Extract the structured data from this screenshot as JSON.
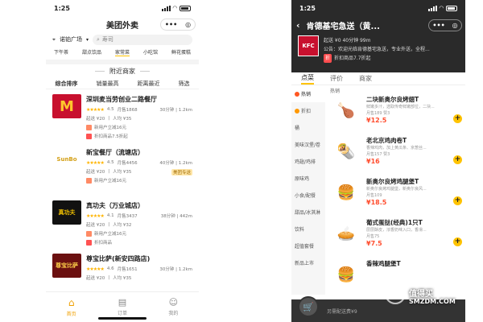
{
  "left": {
    "time": "1:25",
    "title": "美团外卖",
    "capsule_dots": "•••",
    "location": "诺铂广场",
    "search_placeholder": "寿司",
    "categories": [
      "下午茶",
      "甜点饮品",
      "家常菜",
      "小吃馆",
      "鲜花蛋糕"
    ],
    "active_category_index": 2,
    "nearby_title": "附近商家",
    "sorts": [
      "综合排序",
      "销量最高",
      "距离最近",
      "筛选"
    ],
    "shops": [
      {
        "name": "深圳麦当劳创业二路餐厅",
        "rating": "4.5",
        "sales": "月售1868",
        "min": "起送 ¥20",
        "fee": "人均 ¥35",
        "time": "30分钟",
        "dist": "1.2km",
        "tags": [
          "新用户立减16元",
          "折扣商品7.5折起"
        ],
        "tag_colors": [
          "#ff8a65",
          "#ff5252"
        ],
        "logo_text": "M",
        "logo_bg": "#c8102e",
        "logo_color": "#ffc72c",
        "badge": ""
      },
      {
        "name": "新宝餐厅（流塘店）",
        "rating": "4.5",
        "sales": "月售4456",
        "min": "起送 ¥20",
        "fee": "人均 ¥35",
        "time": "40分钟",
        "dist": "1.2km",
        "tags": [
          "新用户立减16元"
        ],
        "tag_colors": [
          "#ff8a65"
        ],
        "logo_text": "SunBo",
        "logo_bg": "#fff",
        "logo_color": "#d4a017",
        "badge": "美团专送"
      },
      {
        "name": "真功夫（万业城店）",
        "rating": "4.1",
        "sales": "月售3437",
        "min": "起送 ¥20",
        "fee": "人均 ¥32",
        "time": "38分钟",
        "dist": "442m",
        "tags": [
          "新用户立减16元",
          "折扣商品"
        ],
        "tag_colors": [
          "#ff8a65",
          "#ff5252"
        ],
        "logo_text": "真功夫",
        "logo_bg": "#111",
        "logo_color": "#f5c400",
        "badge": ""
      },
      {
        "name": "尊宝比萨(新安四路店)",
        "rating": "4.6",
        "sales": "月售1651",
        "min": "起送 ¥20",
        "fee": "人均 ¥35",
        "time": "30分钟",
        "dist": "1.2km",
        "tags": [],
        "tag_colors": [],
        "logo_text": "尊宝比萨",
        "logo_bg": "#6b1010",
        "logo_color": "#ffd24a",
        "badge": ""
      }
    ],
    "tabs": [
      "首页",
      "订单",
      "我的"
    ]
  },
  "right": {
    "time": "1:25",
    "title": "肯德基宅急送（黄...",
    "capsule_dots": "•••",
    "line1": "起送 ¥0   40分钟   99m",
    "notice": "公告：欢迎光临肯德基宅急送，专业外送，全程...",
    "promo_tag": "折",
    "promo": "折扣商品7.7折起",
    "logo_text": "KFC",
    "tabs": [
      "点菜",
      "评价",
      "商家"
    ],
    "side": [
      "热销",
      "折扣",
      "桶",
      "美味汉堡/卷",
      "鸡翅/鸡排",
      "原味鸡",
      "小食/配餐",
      "甜品/冰淇淋",
      "饮料",
      "超值套餐",
      "新品上市"
    ],
    "side_colors": [
      "#ff5722",
      "#ff9800"
    ],
    "list_title": "热销",
    "items": [
      {
        "name": "二块新奥尔良烤翅T",
        "desc": "鲜嫩多汁，选取传奇鲜嫩部位，二块...",
        "sale": "月售189  赞3",
        "price": "¥12.5",
        "emoji": "🍗"
      },
      {
        "name": "老北京鸡肉卷T",
        "desc": "香辣鸡肉，加上黄瓜条、京葱丝...",
        "sale": "月售157  赞3",
        "price": "¥16",
        "emoji": "🌯"
      },
      {
        "name": "新奥尔良烤鸡腿堡T",
        "desc": "新奥尔良烤鸡腿堡，新奥尔良风...",
        "sale": "月售109",
        "price": "¥18.5",
        "emoji": "🍔"
      },
      {
        "name": "葡式蛋挞(经典)1只T",
        "desc": "层层酥皮，浓香奶味入口，香滑...",
        "sale": "月售75",
        "price": "¥7.5",
        "emoji": "🥧"
      },
      {
        "name": "香辣鸡腿堡T",
        "desc": "",
        "sale": "",
        "price": "",
        "emoji": "🍔"
      }
    ],
    "cart_text": "另需配送费¥9"
  },
  "watermark": "值得买",
  "watermark2": "SMZDM.COM"
}
